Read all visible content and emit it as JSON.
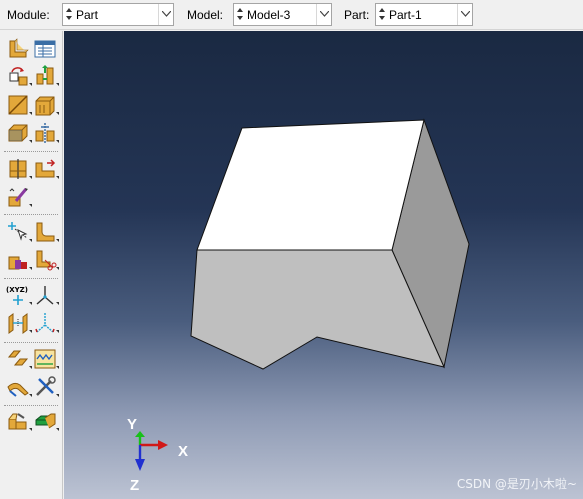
{
  "context_bar": {
    "module": {
      "label": "Module:",
      "value": "Part"
    },
    "model": {
      "label": "Model:",
      "value": "Model-3"
    },
    "part": {
      "label": "Part:",
      "value": "Part-1"
    }
  },
  "toolbox": {
    "tools": [
      "create-part-icon",
      "part-manager-icon",
      "part-transform-icon",
      "create-solid-extrude-icon",
      "create-shell-planar-icon",
      "create-solid-sweep-icon",
      "create-solid-from-shell-icon",
      "create-cut-icon",
      "partition-cell-icon",
      "partition-face-icon",
      "create-datum-edit-icon",
      "create-wire-point-icon",
      "create-round-fillet-icon",
      "repair-geometry-icon",
      "remove-face-icon",
      "create-reference-point-icon",
      "create-csys-icon",
      "create-datum-plane-icon",
      "create-datum-axis-icon",
      "query-geometry-icon",
      "create-virtual-topology-icon",
      "edit-feature-icon",
      "tools-icon",
      "assembly-instance-icon",
      "convert-geometry-icon"
    ]
  },
  "viewport": {
    "triad": {
      "y_label": "Y",
      "x_label": "X",
      "z_label": "Z"
    },
    "watermark": "CSDN @是刃小木啦~"
  }
}
